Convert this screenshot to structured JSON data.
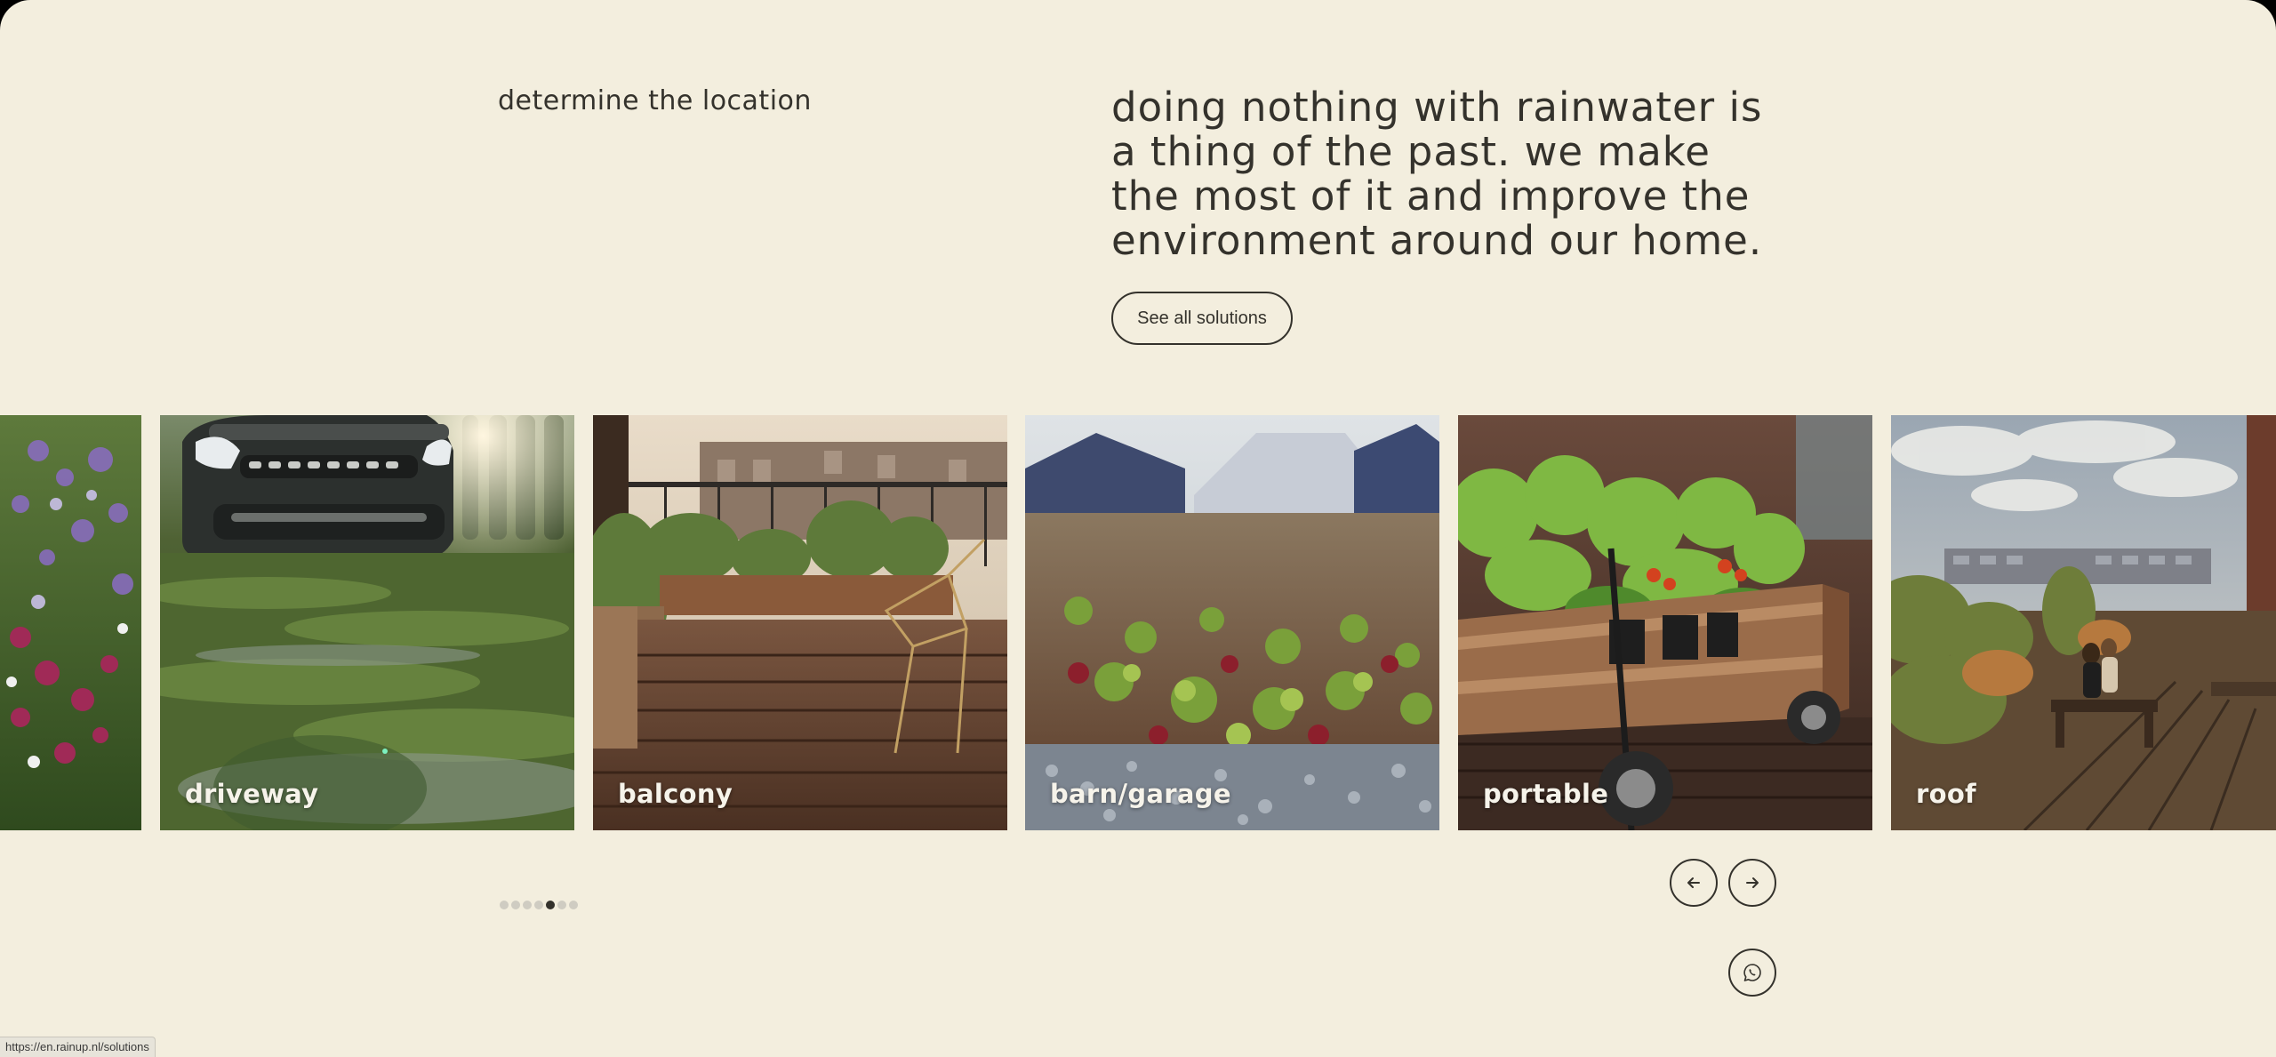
{
  "section": {
    "eyebrow": "determine the location",
    "headline": "doing nothing with rainwater is a thing of the past. we make the most of it and improve the environment around our home.",
    "cta_label": "See all solutions"
  },
  "carousel": {
    "cards": [
      {
        "label": "",
        "image": "garden-flowers"
      },
      {
        "label": "driveway",
        "image": "car-on-grass-driveway"
      },
      {
        "label": "balcony",
        "image": "wooden-balcony-planters"
      },
      {
        "label": "barn/garage",
        "image": "sedum-green-roof"
      },
      {
        "label": "portable",
        "image": "wooden-planter-cart"
      },
      {
        "label": "roof",
        "image": "rooftop-terrace"
      }
    ],
    "dots_total": 7,
    "active_dot": 4,
    "prev_icon": "arrow-left-icon",
    "next_icon": "arrow-right-icon"
  },
  "whatsapp_icon": "whatsapp-icon",
  "status_bar": {
    "url": "https://en.rainup.nl/solutions"
  },
  "colors": {
    "background": "#f3eede",
    "text": "#34322c",
    "dot_inactive": "#cfccc2",
    "dot_active": "#34322c"
  }
}
